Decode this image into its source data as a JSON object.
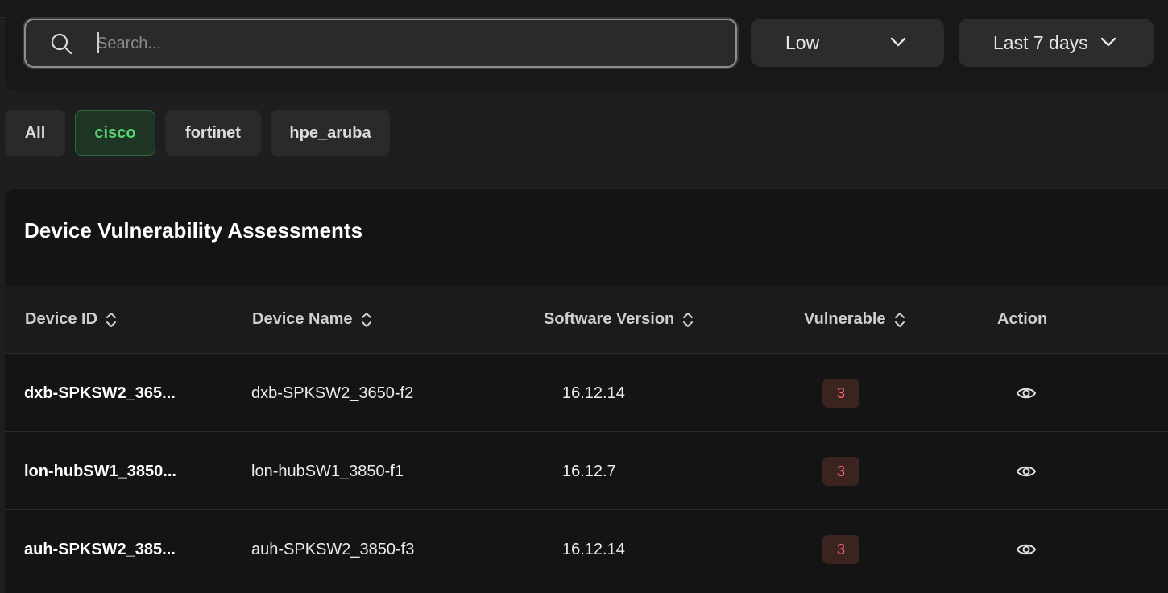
{
  "filters": {
    "search_placeholder": "Search...",
    "search_value": "",
    "severity_selected": "Low",
    "range_selected": "Last 7 days"
  },
  "vendor_tabs": [
    {
      "label": "All",
      "active": false
    },
    {
      "label": "cisco",
      "active": true
    },
    {
      "label": "fortinet",
      "active": false
    },
    {
      "label": "hpe_aruba",
      "active": false
    }
  ],
  "card": {
    "title": "Device Vulnerability Assessments"
  },
  "table": {
    "columns": [
      "Device ID",
      "Device Name",
      "Software Version",
      "Vulnerable",
      "Action"
    ],
    "rows": [
      {
        "device_id": "dxb-SPKSW2_365...",
        "device_name": "dxb-SPKSW2_3650-f2",
        "software_version": "16.12.14",
        "vulnerable": "3"
      },
      {
        "device_id": "lon-hubSW1_3850...",
        "device_name": "lon-hubSW1_3850-f1",
        "software_version": "16.12.7",
        "vulnerable": "3"
      },
      {
        "device_id": "auh-SPKSW2_385...",
        "device_name": "auh-SPKSW2_3850-f3",
        "software_version": "16.12.14",
        "vulnerable": "3"
      }
    ]
  },
  "colors": {
    "background": "#1e1e1e",
    "panel": "#141414",
    "active_tab_text": "#58d26e",
    "vulnerable_badge_text": "#ff6e6e",
    "vulnerable_badge_bg": "#3b2420"
  },
  "icons": {
    "search": "search-icon",
    "dropdown": "chevron-down-icon",
    "sort": "sort-icon",
    "view": "eye-icon"
  }
}
